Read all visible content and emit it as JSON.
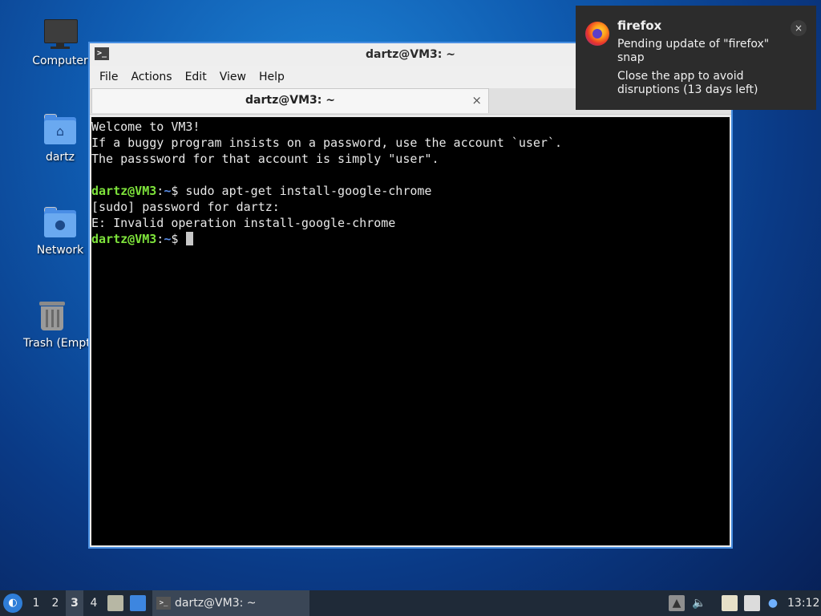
{
  "desktop": {
    "icons": [
      {
        "label": "Computer"
      },
      {
        "label": "dartz"
      },
      {
        "label": "Network"
      },
      {
        "label": "Trash (Empty)"
      }
    ]
  },
  "terminal": {
    "window_title": "dartz@VM3: ~",
    "icon_glyph": ">_",
    "menu": [
      "File",
      "Actions",
      "Edit",
      "View",
      "Help"
    ],
    "tab": {
      "title": "dartz@VM3: ~",
      "close_glyph": "×"
    },
    "lines": {
      "l1": "Welcome to VM3!",
      "l2": "If a buggy program insists on a password, use the account `user`.",
      "l3": "The passsword for that account is simply \"user\".",
      "l4": "",
      "prompt_user": "dartz@VM3",
      "prompt_sep": ":",
      "prompt_path": "~",
      "prompt_dollar": "$ ",
      "cmd1": "sudo apt-get install-google-chrome",
      "l6": "[sudo] password for dartz:",
      "l7": "E: Invalid operation install-google-chrome"
    }
  },
  "notification": {
    "app": "firefox",
    "line1": "Pending update of \"firefox\"",
    "line2": "snap",
    "line3": "Close the app to avoid",
    "line4": "disruptions (13 days left)",
    "close_glyph": "×"
  },
  "taskbar": {
    "start_glyph": "◐",
    "workspaces": [
      "1",
      "2",
      "3",
      "4"
    ],
    "active_workspace": "3",
    "task_label": "dartz@VM3: ~",
    "task_icon_glyph": ">_",
    "clock": "13:12",
    "tray_icons": [
      "update-icon",
      "volume-icon",
      "clipboard-icon",
      "network-icon",
      "notification-icon"
    ]
  },
  "colors": {
    "prompt_user": "#7ee33b",
    "prompt_path": "#5b8ee8",
    "window_border": "#4a90e2",
    "terminal_bg": "#000000"
  }
}
